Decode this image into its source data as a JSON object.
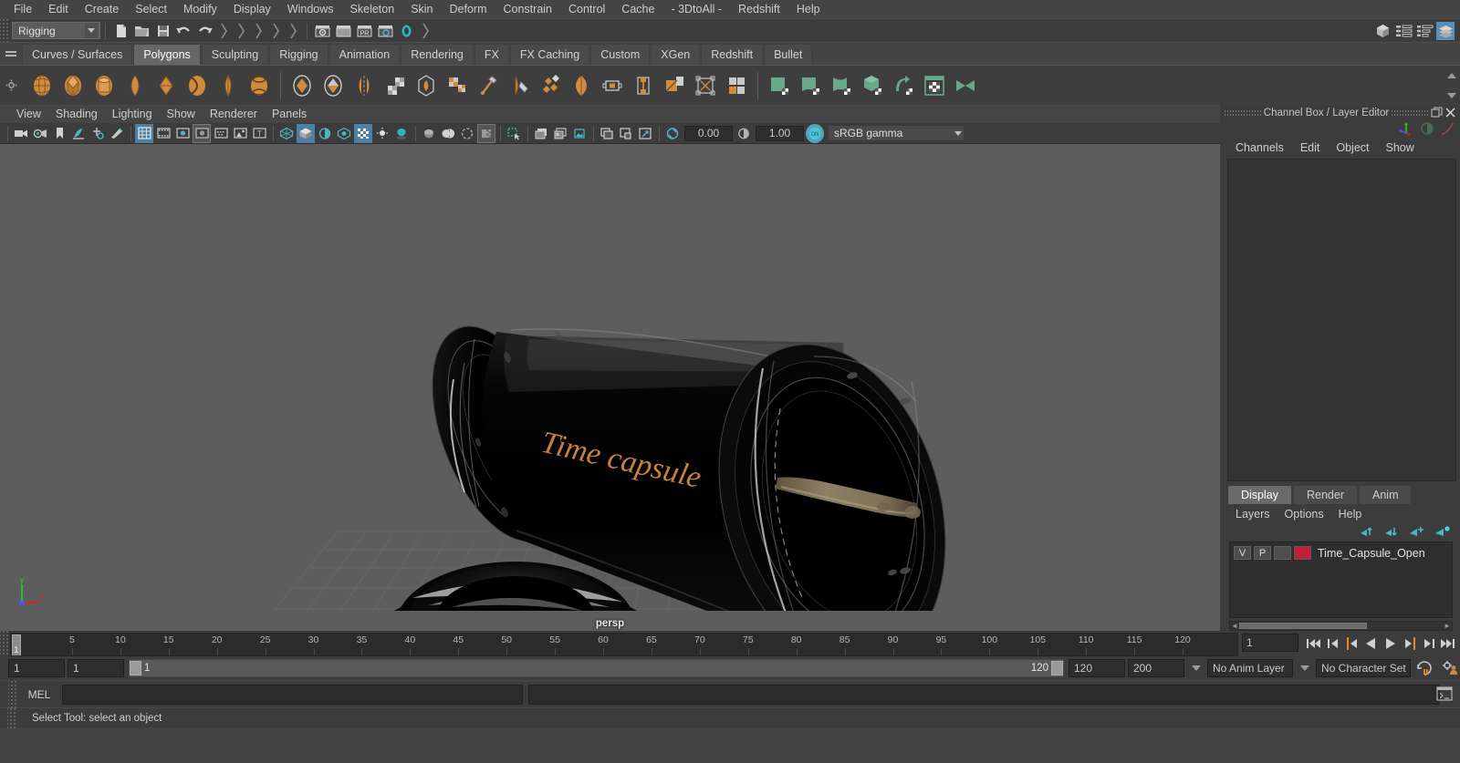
{
  "app": {
    "menus": [
      "File",
      "Edit",
      "Create",
      "Select",
      "Modify",
      "Display",
      "Windows",
      "Skeleton",
      "Skin",
      "Deform",
      "Constrain",
      "Control",
      "Cache",
      "- 3DtoAll -",
      "Redshift",
      "Help"
    ]
  },
  "status_line": {
    "menu_set": "Rigging",
    "icons": [
      "new-scene-icon",
      "open-scene-icon",
      "save-scene-icon",
      "undo-icon",
      "redo-icon",
      "select-by-hierarchy-icon",
      "select-by-object-icon",
      "select-by-component-icon",
      "snap-grid-icon",
      "snap-curve-icon",
      "render-view-icon",
      "render-current-frame-icon",
      "ipr-render-icon",
      "render-settings-icon",
      "redshift-render-icon"
    ],
    "right_icons": [
      "modeling-toolkit-icon",
      "attribute-editor-icon",
      "tool-settings-icon",
      "channel-box-icon"
    ]
  },
  "shelf": {
    "tabs": [
      "Curves / Surfaces",
      "Polygons",
      "Sculpting",
      "Rigging",
      "Animation",
      "Rendering",
      "FX",
      "FX Caching",
      "Custom",
      "XGen",
      "Redshift",
      "Bullet"
    ],
    "active_tab": "Polygons",
    "buttons": [
      "poly-sphere-icon",
      "poly-cube-icon",
      "poly-cylinder-icon",
      "poly-cone-icon",
      "poly-plane-icon",
      "poly-torus-icon",
      "poly-prism-icon",
      "poly-pyramid-icon",
      "poly-pipe-icon",
      "poly-helix-icon",
      "poly-soccer-ball-icon",
      "poly-platonic-icon",
      "poly-combine-icon",
      "poly-separate-icon",
      "poly-mirror-icon",
      "poly-extrude-icon",
      "poly-bevel-icon",
      "poly-bridge-icon",
      "poly-append-icon",
      "poly-create-icon",
      "poly-multicut-icon",
      "poly-target-weld-icon",
      "poly-smooth-icon",
      "poly-reduce-icon",
      "poly-transfer-icon",
      "poly-sculpt-icon",
      "uv-editor-icon",
      "uv-unfold-icon",
      "uv-layout-icon",
      "uv-cut-icon",
      "uv-planar-icon",
      "uv-automatic-icon",
      "uv-camera-icon",
      "uv-snapshot-icon"
    ]
  },
  "viewport": {
    "menus": [
      "View",
      "Shading",
      "Lighting",
      "Show",
      "Renderer",
      "Panels"
    ],
    "toolbar": {
      "exposure": "0.00",
      "gamma": "1.00",
      "color_management": "sRGB gamma",
      "icons": [
        "select-camera-icon",
        "camera-attributes-icon",
        "bookmark-icon",
        "image-plane-icon",
        "two-d-pan-zoom-icon",
        "grease-pencil-icon",
        "grid-toggle-icon",
        "film-gate-icon",
        "resolution-gate-icon",
        "gate-mask-icon",
        "film-origin-icon",
        "safe-action-icon",
        "safe-title-icon",
        "wireframe-icon",
        "smooth-shade-icon",
        "shaded-wireframe-icon",
        "textured-icon",
        "use-all-lights-icon",
        "shadows-icon",
        "ambient-occlusion-icon",
        "motion-blur-icon",
        "multisample-icon",
        "xray-icon",
        "xray-joints-icon",
        "xray-active-components-icon",
        "isolate-select-icon",
        "viewport-snapshot-icon",
        "view-sequence-icon",
        "view-image-icon"
      ]
    },
    "camera_label": "persp",
    "axis": {
      "x": "x",
      "y": "y"
    },
    "object_label": "Time capsule",
    "object_label_color": "#d4883a"
  },
  "channel_box": {
    "title": "Channel Box / Layer Editor",
    "menus": [
      "Channels",
      "Edit",
      "Object",
      "Show"
    ],
    "side_icons": [
      "move-axis-icon",
      "shading-icon",
      "anim-curve-icon"
    ]
  },
  "layer_editor": {
    "tabs": [
      "Display",
      "Render",
      "Anim"
    ],
    "active_tab": "Display",
    "menus": [
      "Layers",
      "Options",
      "Help"
    ],
    "toolbar_icons": [
      "move-layer-up-icon",
      "move-layer-down-icon",
      "new-layer-icon",
      "new-layer-from-selected-icon"
    ],
    "columns": [
      "V",
      "P"
    ],
    "layers": [
      {
        "visible": "V",
        "playback": "P",
        "color": "#c41e3a",
        "name": "Time_Capsule_Open"
      }
    ]
  },
  "time_slider": {
    "tick_labels": [
      "5",
      "10",
      "15",
      "20",
      "25",
      "30",
      "35",
      "40",
      "45",
      "50",
      "55",
      "60",
      "65",
      "70",
      "75",
      "80",
      "85",
      "90",
      "95",
      "100",
      "105",
      "110",
      "115",
      "120"
    ],
    "current_frame": "1",
    "current_frame_field": "1",
    "playback_icons": [
      "go-to-start-icon",
      "step-back-frame-icon",
      "step-back-key-icon",
      "play-backwards-icon",
      "play-forwards-icon",
      "step-forward-key-icon",
      "step-forward-frame-icon",
      "go-to-end-icon"
    ]
  },
  "range_slider": {
    "anim_start": "1",
    "range_start": "1",
    "slider_start": "1",
    "slider_end": "120",
    "range_end": "120",
    "anim_end": "200",
    "anim_layer": "No Anim Layer",
    "character_set": "No Character Set",
    "icons": [
      "auto-key-icon",
      "animation-preferences-icon"
    ]
  },
  "command_line": {
    "label": "MEL",
    "input_value": "",
    "output_value": "",
    "script-editor-icon": "script-editor-icon"
  },
  "help_line": {
    "text": "Select Tool: select an object"
  },
  "colors": {
    "bg": "#444444",
    "panel": "#3c3c3c",
    "accent_orange": "#d08c3c",
    "accent_green": "#6aa88a",
    "accent_blue": "#5b8fb8",
    "viewport_bg": "#5d5d5d"
  }
}
